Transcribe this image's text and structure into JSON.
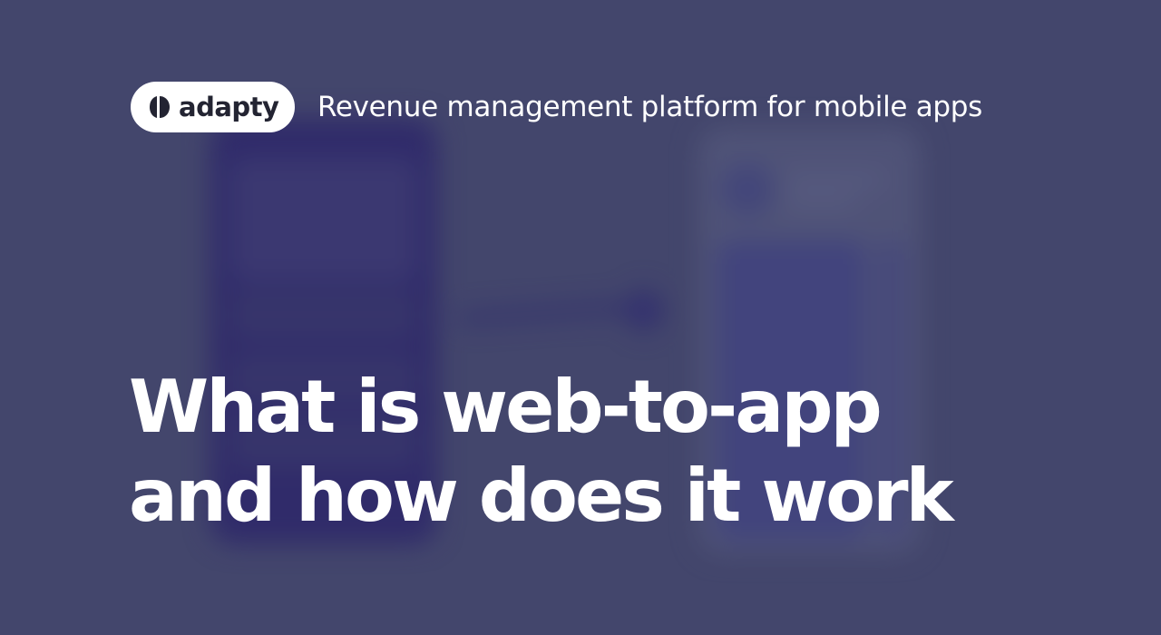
{
  "brand": {
    "logo_icon": "adapty-logo-icon",
    "logo_text": "adapty",
    "tagline": "Revenue management platform for mobile apps"
  },
  "title": {
    "line1": "What is web-to-app",
    "line2": "and how does it work"
  },
  "colors": {
    "background": "#474a70",
    "text": "#ffffff",
    "logo_pill": "#ffffff",
    "logo_text": "#232432"
  }
}
